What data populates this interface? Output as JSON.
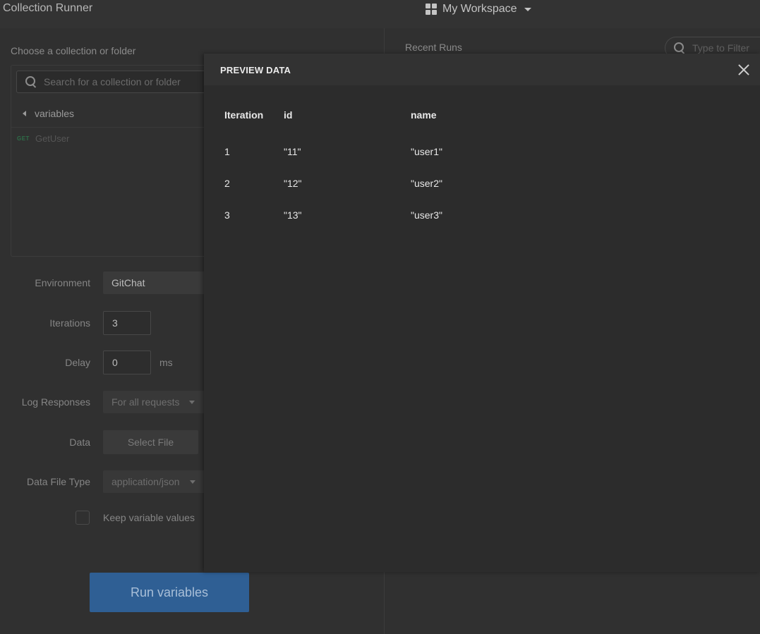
{
  "app": {
    "title": "Collection Runner"
  },
  "workspace": {
    "label": "My Workspace",
    "icon": "grid-icon"
  },
  "left": {
    "choose_label": "Choose a collection or folder",
    "search_placeholder": "Search for a collection or folder",
    "collection_name": "variables",
    "request": {
      "method": "GET",
      "name": "GetUser"
    },
    "environment": {
      "label": "Environment",
      "value": "GitChat"
    },
    "iterations": {
      "label": "Iterations",
      "value": "3"
    },
    "delay": {
      "label": "Delay",
      "value": "0",
      "unit": "ms"
    },
    "log_responses": {
      "label": "Log Responses",
      "value": "For all requests"
    },
    "data": {
      "label": "Data",
      "button": "Select File"
    },
    "data_file_type": {
      "label": "Data File Type",
      "value": "application/json"
    },
    "keep_values": {
      "label": "Keep variable values",
      "checked": false
    },
    "run_button": "Run variables"
  },
  "right": {
    "recent_runs": "Recent Runs",
    "filter_placeholder": "Type to Filter"
  },
  "modal": {
    "title": "PREVIEW DATA",
    "columns": [
      "Iteration",
      "id",
      "name"
    ],
    "rows": [
      [
        "1",
        "\"11\"",
        "\"user1\""
      ],
      [
        "2",
        "\"12\"",
        "\"user2\""
      ],
      [
        "3",
        "\"13\"",
        "\"user3\""
      ]
    ]
  },
  "colors": {
    "accent": "#2f5f94",
    "background": "#303030",
    "modal": "#2c2c2c"
  }
}
